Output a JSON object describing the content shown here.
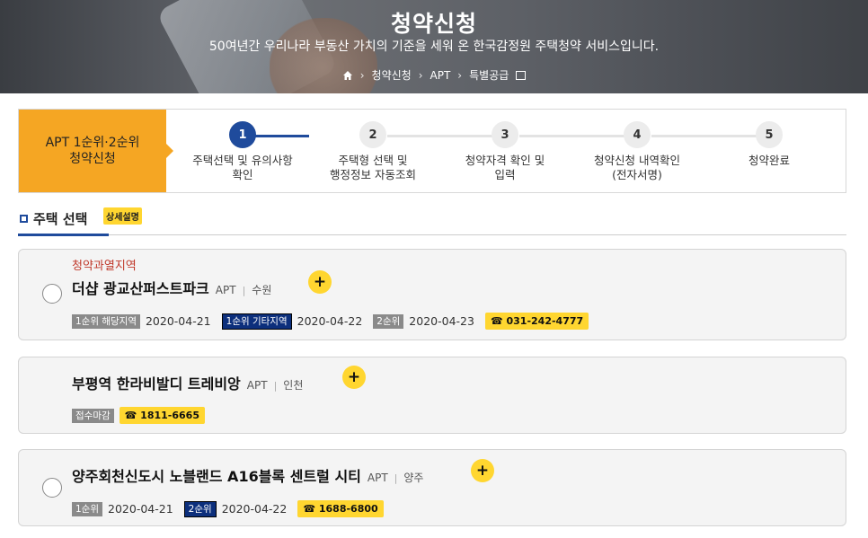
{
  "hero": {
    "title": "청약신청",
    "subtitle": "50여년간 우리나라 부동산 가치의 기준을 세워 온 한국감정원 주택청약 서비스입니다.",
    "breadcrumbs": [
      "청약신청",
      "APT",
      "특별공급"
    ]
  },
  "steps": {
    "label_line1": "APT 1순위·2순위",
    "label_line2": "청약신청",
    "items": [
      {
        "num": "1",
        "text": "주택선택 및 유의사항\n확인",
        "active": true
      },
      {
        "num": "2",
        "text": "주택형 선택 및\n행정정보 자동조회",
        "active": false
      },
      {
        "num": "3",
        "text": "청약자격 확인 및\n입력",
        "active": false
      },
      {
        "num": "4",
        "text": "청약신청 내역확인\n(전자서명)",
        "active": false
      },
      {
        "num": "5",
        "text": "청약완료",
        "active": false
      }
    ]
  },
  "section": {
    "title": "주택 선택",
    "detail": "상세설명"
  },
  "cards": [
    {
      "region_tag": "청약과열지역",
      "name": "더샵 광교산퍼스트파크",
      "type": "APT",
      "location": "수원",
      "schedule": [
        {
          "badge": "1순위 해당지역",
          "date": "2020-04-21",
          "style": "gray"
        },
        {
          "badge": "1순위 기타지역",
          "date": "2020-04-22",
          "style": "blue"
        },
        {
          "badge": "2순위",
          "date": "2020-04-23",
          "style": "gray"
        }
      ],
      "phone": "☎ 031-242-4777"
    },
    {
      "name": "부평역 한라비발디 트레비앙",
      "type": "APT",
      "location": "인천",
      "status": "접수마감",
      "phone": "☎ 1811-6665"
    },
    {
      "name": "양주회천신도시 노블랜드 A16블록 센트럴 시티",
      "type": "APT",
      "location": "양주",
      "schedule": [
        {
          "badge": "1순위",
          "date": "2020-04-21",
          "style": "gray"
        },
        {
          "badge": "2순위",
          "date": "2020-04-22",
          "style": "blue"
        }
      ],
      "phone": "☎ 1688-6800"
    }
  ],
  "colors": {
    "accent_orange": "#f5a623",
    "primary_blue": "#1f4b9c",
    "badge_yellow": "#ffd630",
    "region_red": "#c0392b"
  }
}
